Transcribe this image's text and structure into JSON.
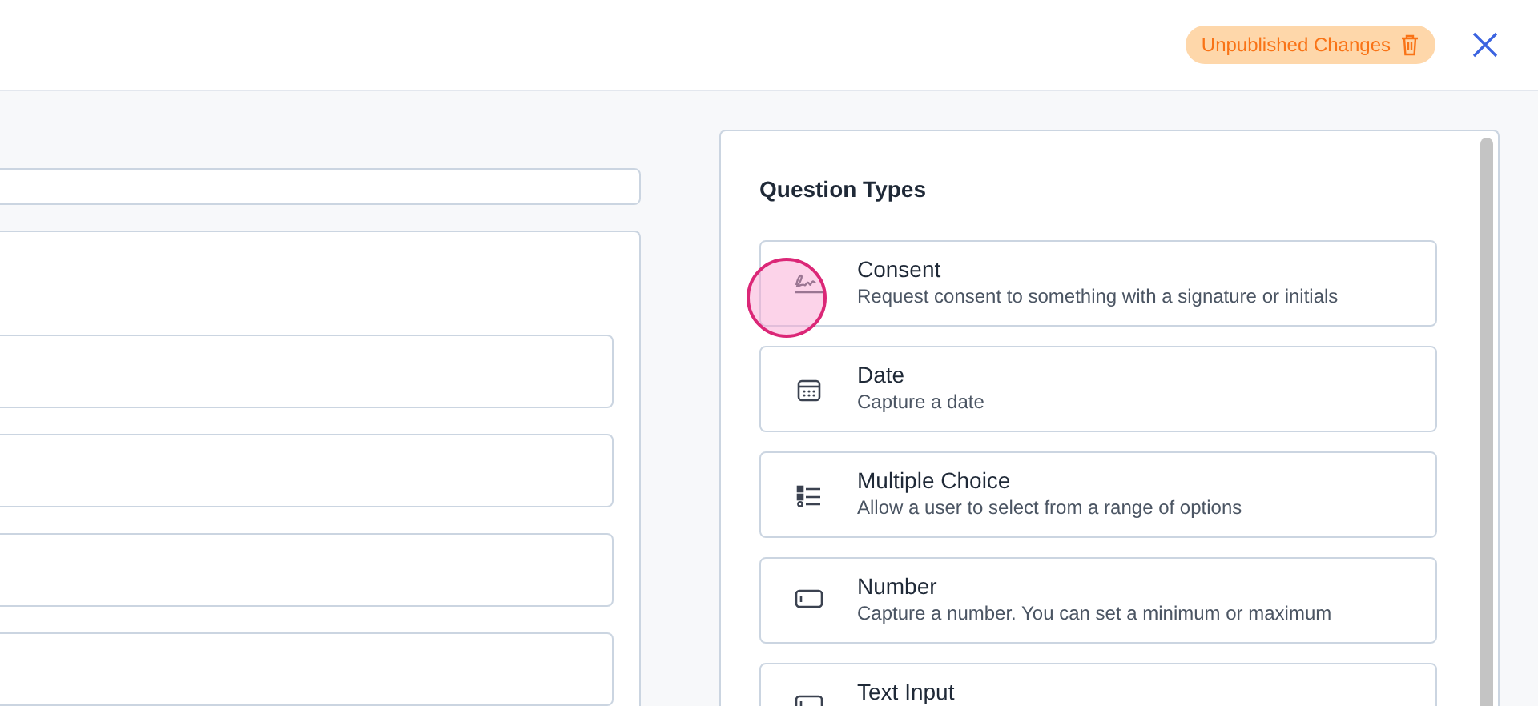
{
  "header": {
    "status_badge": "Unpublished Changes"
  },
  "question_types": {
    "title": "Question Types",
    "items": [
      {
        "kind": "consent",
        "name": "Consent",
        "description": "Request consent to something with a signature or initials"
      },
      {
        "kind": "date",
        "name": "Date",
        "description": "Capture a date"
      },
      {
        "kind": "choice",
        "name": "Multiple Choice",
        "description": "Allow a user to select from a range of options"
      },
      {
        "kind": "number",
        "name": "Number",
        "description": "Capture a number. You can set a minimum or maximum"
      },
      {
        "kind": "text",
        "name": "Text Input"
      }
    ]
  }
}
